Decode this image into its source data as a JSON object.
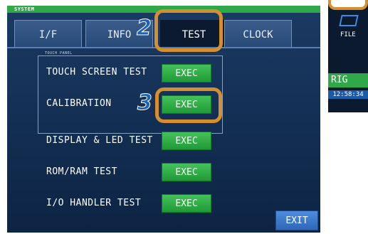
{
  "window": {
    "title": "SYSTEM"
  },
  "tabs": [
    {
      "label": "I/F"
    },
    {
      "label": "INFO"
    },
    {
      "label": "TEST"
    },
    {
      "label": "CLOCK"
    }
  ],
  "panel": {
    "label": "TOUCH PANEL"
  },
  "rows": [
    {
      "label": "TOUCH SCREEN TEST",
      "button": "EXEC"
    },
    {
      "label": "CALIBRATION",
      "button": "EXEC"
    },
    {
      "label": "DISPLAY & LED TEST",
      "button": "EXEC"
    },
    {
      "label": "ROM/RAM TEST",
      "button": "EXEC"
    },
    {
      "label": "I/O HANDLER TEST",
      "button": "EXEC"
    }
  ],
  "exit_label": "EXIT",
  "callouts": [
    {
      "number": "2"
    },
    {
      "number": "3"
    }
  ],
  "side": {
    "file_label": "FILE",
    "trig_label": "RIG",
    "time": "12:58:34"
  },
  "colors": {
    "accent_green": "#2fa84a",
    "callout_orange": "#d68f2e",
    "callout_blue": "#1d63b7"
  }
}
